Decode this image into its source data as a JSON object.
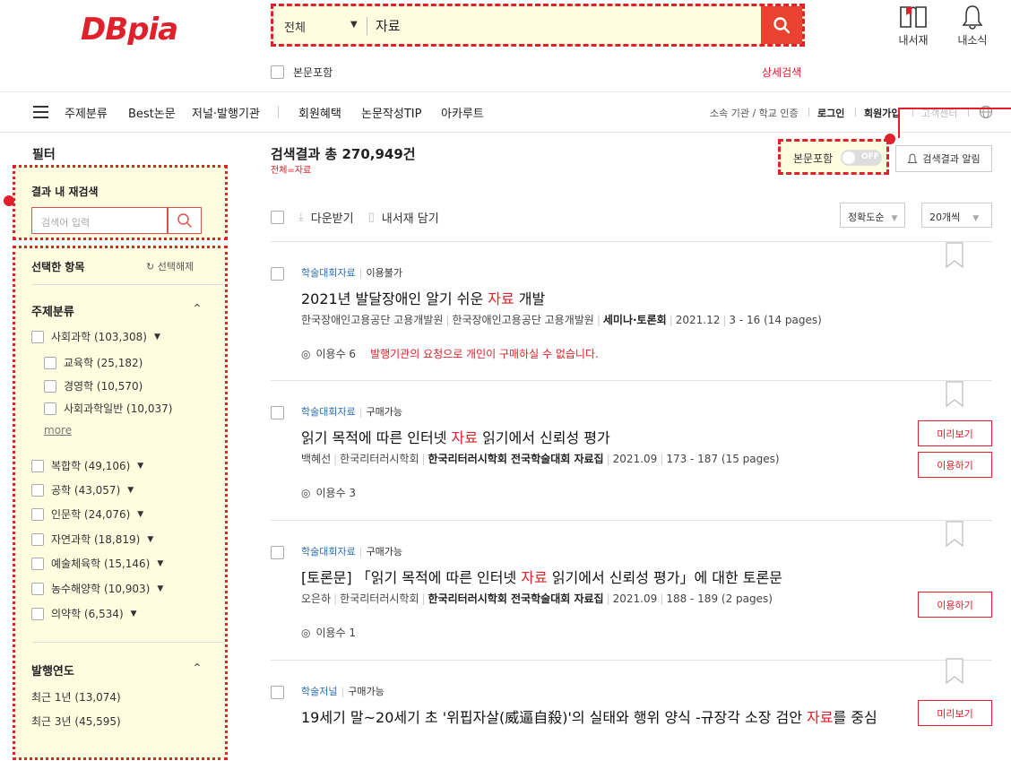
{
  "header": {
    "logo_text": "DBpia",
    "search_scope": "전체",
    "search_query": "자료",
    "fulltext_label": "본문포함",
    "advanced_search": "상세검색",
    "my_library": "내서재",
    "my_news": "내소식"
  },
  "nav": {
    "items": [
      "주제분류",
      "Best논문",
      "저널·발행기관",
      "회원혜택",
      "논문작성TIP",
      "아카루트"
    ],
    "util": [
      "소속 기관 / 학교 인증",
      "로그인",
      "회원가입",
      "고객센터"
    ]
  },
  "sidebar": {
    "title": "필터",
    "research_title": "결과 내 재검색",
    "research_placeholder": "검색어 입력",
    "selected_title": "선택한 항목",
    "clear_label": "선택해제",
    "subject_title": "주제분류",
    "subjects": [
      {
        "label": "사회과학 (103,308)"
      },
      {
        "label": "교육학 (25,182)"
      },
      {
        "label": "경영학 (10,570)"
      },
      {
        "label": "사회과학일반 (10,037)"
      },
      {
        "label": "복합학 (49,106)"
      },
      {
        "label": "공학 (43,057)"
      },
      {
        "label": "인문학 (24,076)"
      },
      {
        "label": "자연과학 (18,819)"
      },
      {
        "label": "예술체육학 (15,146)"
      },
      {
        "label": "농수해양학 (10,903)"
      },
      {
        "label": "의약학 (6,534)"
      }
    ],
    "more_label": "more",
    "year_title": "발행연도",
    "years": [
      "최근 1년 (13,074)",
      "최근 3년 (45,595)"
    ]
  },
  "results": {
    "title": "검색결과 총 270,949건",
    "sub": "전체=자료",
    "fulltext_toggle_label": "본문포함",
    "fulltext_toggle_state": "OFF",
    "alert_label": "검색결과 알림",
    "download_label": "다운받기",
    "save_label": "내서재 담기",
    "sort_label": "정확도순",
    "per_page_label": "20개씩",
    "items": [
      {
        "type": "학술대회자료",
        "availability": "이용불가",
        "title_pre": "2021년 발달장애인 알기 쉬운 ",
        "title_hl": "자료",
        "title_post": " 개발",
        "m1": "한국장애인고용공단 고용개발원",
        "m2": "한국장애인고용공단 고용개발원",
        "m3": "세미나·토론회",
        "m3_hl": "",
        "m4": "2021.12",
        "m5": "3 - 16 (14 pages)",
        "views": "이용수 6",
        "notice": "발행기관의 요청으로 개인이 구매하실 수 없습니다."
      },
      {
        "type": "학술대회자료",
        "availability": "구매가능",
        "title_pre": "읽기 목적에 따른 인터넷 ",
        "title_hl": "자료",
        "title_post": " 읽기에서 신뢰성 평가",
        "m1": "백혜선",
        "m2": "한국리터러시학회",
        "m3": "한국리터러시학회 전국학술대회 ",
        "m3_hl": "자료집",
        "m4": "2021.09",
        "m5": "173 - 187 (15 pages)",
        "views": "이용수 3",
        "notice": "",
        "btn_preview": "미리보기",
        "btn_use": "이용하기"
      },
      {
        "type": "학술대회자료",
        "availability": "구매가능",
        "title_pre": "[토론문] 「읽기 목적에 따른 인터넷 ",
        "title_hl": "자료",
        "title_post": " 읽기에서 신뢰성 평가」에 대한 토론문",
        "m1": "오은하",
        "m2": "한국리터러시학회",
        "m3": "한국리터러시학회 전국학술대회 ",
        "m3_hl": "자료집",
        "m4": "2021.09",
        "m5": "188 - 189 (2 pages)",
        "views": "이용수 1",
        "notice": "",
        "btn_use": "이용하기"
      },
      {
        "type": "학술저널",
        "availability": "구매가능",
        "title_pre": "19세기 말~20세기 초 '위핍자살(威逼自殺)'의 실태와 행위 양식 -규장각 소장 검안 ",
        "title_hl": "자료",
        "title_post": "를 중심",
        "btn_preview": "미리보기"
      }
    ]
  },
  "colors": {
    "accent": "#e0202a",
    "highlight_bg": "#fffde0",
    "search_button": "#e9432f",
    "link_blue": "#2d6db5"
  }
}
